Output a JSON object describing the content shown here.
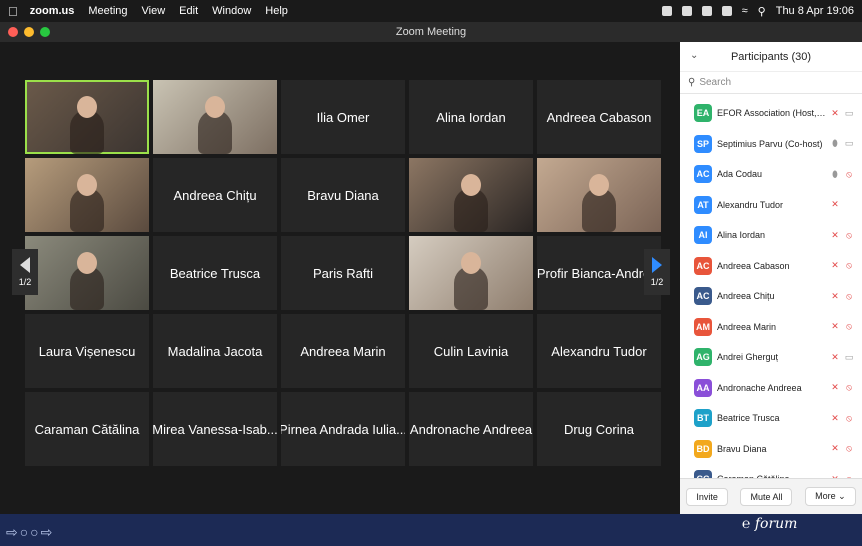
{
  "menubar": {
    "app": "zoom.us",
    "items": [
      "Meeting",
      "View",
      "Edit",
      "Window",
      "Help"
    ],
    "clock": "Thu 8 Apr  19:06"
  },
  "window": {
    "title": "Zoom Meeting"
  },
  "grid": {
    "tiles": [
      {
        "label": "",
        "video": "v1",
        "active": true
      },
      {
        "label": "",
        "video": "v2"
      },
      {
        "label": "Ilia Omer"
      },
      {
        "label": "Alina Iordan"
      },
      {
        "label": "Andreea Cabason"
      },
      {
        "label": "",
        "video": "v3"
      },
      {
        "label": "Andreea Chițu"
      },
      {
        "label": "Bravu Diana"
      },
      {
        "label": "",
        "video": "v4"
      },
      {
        "label": "",
        "video": "v5"
      },
      {
        "label": "",
        "video": "v6"
      },
      {
        "label": "Beatrice Trusca"
      },
      {
        "label": "Paris Rafti"
      },
      {
        "label": "",
        "video": "v7"
      },
      {
        "label": "Profir Bianca-Andre..."
      },
      {
        "label": "Laura Vișenescu"
      },
      {
        "label": "Madalina Jacota"
      },
      {
        "label": "Andreea Marin"
      },
      {
        "label": "Culin Lavinia"
      },
      {
        "label": "Alexandru Tudor"
      },
      {
        "label": "Caraman Cătălina"
      },
      {
        "label": "Mirea Vanessa-Isab..."
      },
      {
        "label": "Pirnea Andrada Iulia..."
      },
      {
        "label": "Andronache Andreea"
      },
      {
        "label": "Drug Corina"
      }
    ],
    "page_left": "1/2",
    "page_right": "1/2"
  },
  "participants": {
    "title": "Participants (30)",
    "search_placeholder": "Search",
    "list": [
      {
        "initials": "EA",
        "name": "EFOR Association (Host, me)",
        "color": "#2fb36b",
        "mic": "muted",
        "cam": "on"
      },
      {
        "initials": "SP",
        "name": "Septimius Parvu (Co-host)",
        "color": "#2f8cff",
        "mic": "on",
        "cam": "on"
      },
      {
        "initials": "AC",
        "name": "Ada Codau",
        "color": "#2f8cff",
        "mic": "on",
        "cam": "off"
      },
      {
        "initials": "AT",
        "name": "Alexandru Tudor",
        "color": "#2f8cff",
        "mic": "muted",
        "cam": ""
      },
      {
        "initials": "AI",
        "name": "Alina Iordan",
        "color": "#2f8cff",
        "mic": "muted",
        "cam": "off"
      },
      {
        "initials": "AC",
        "name": "Andreea Cabason",
        "color": "#e8553b",
        "mic": "muted",
        "cam": "off"
      },
      {
        "initials": "AC",
        "name": "Andreea Chițu",
        "color": "#3a5a8c",
        "mic": "muted",
        "cam": "off"
      },
      {
        "initials": "AM",
        "name": "Andreea Marin",
        "color": "#e8553b",
        "mic": "muted",
        "cam": "off"
      },
      {
        "initials": "AG",
        "name": "Andrei Gherguț",
        "color": "#2fb36b",
        "mic": "muted",
        "cam": "on"
      },
      {
        "initials": "AA",
        "name": "Andronache Andreea",
        "color": "#8a4fd8",
        "mic": "muted",
        "cam": "off"
      },
      {
        "initials": "BT",
        "name": "Beatrice Trusca",
        "color": "#1da1c9",
        "mic": "muted",
        "cam": "off"
      },
      {
        "initials": "BD",
        "name": "Bravu Diana",
        "color": "#f2a81d",
        "mic": "muted",
        "cam": "off"
      },
      {
        "initials": "CC",
        "name": "Caraman Cătălina",
        "color": "#3a5a8c",
        "mic": "muted",
        "cam": "off"
      }
    ],
    "invite": "Invite",
    "mute_all": "Mute All",
    "more": "More"
  },
  "colors": {
    "active_speaker": "#9be04a",
    "muted": "#e34a4a",
    "page_arrow": "#2f8cff"
  }
}
